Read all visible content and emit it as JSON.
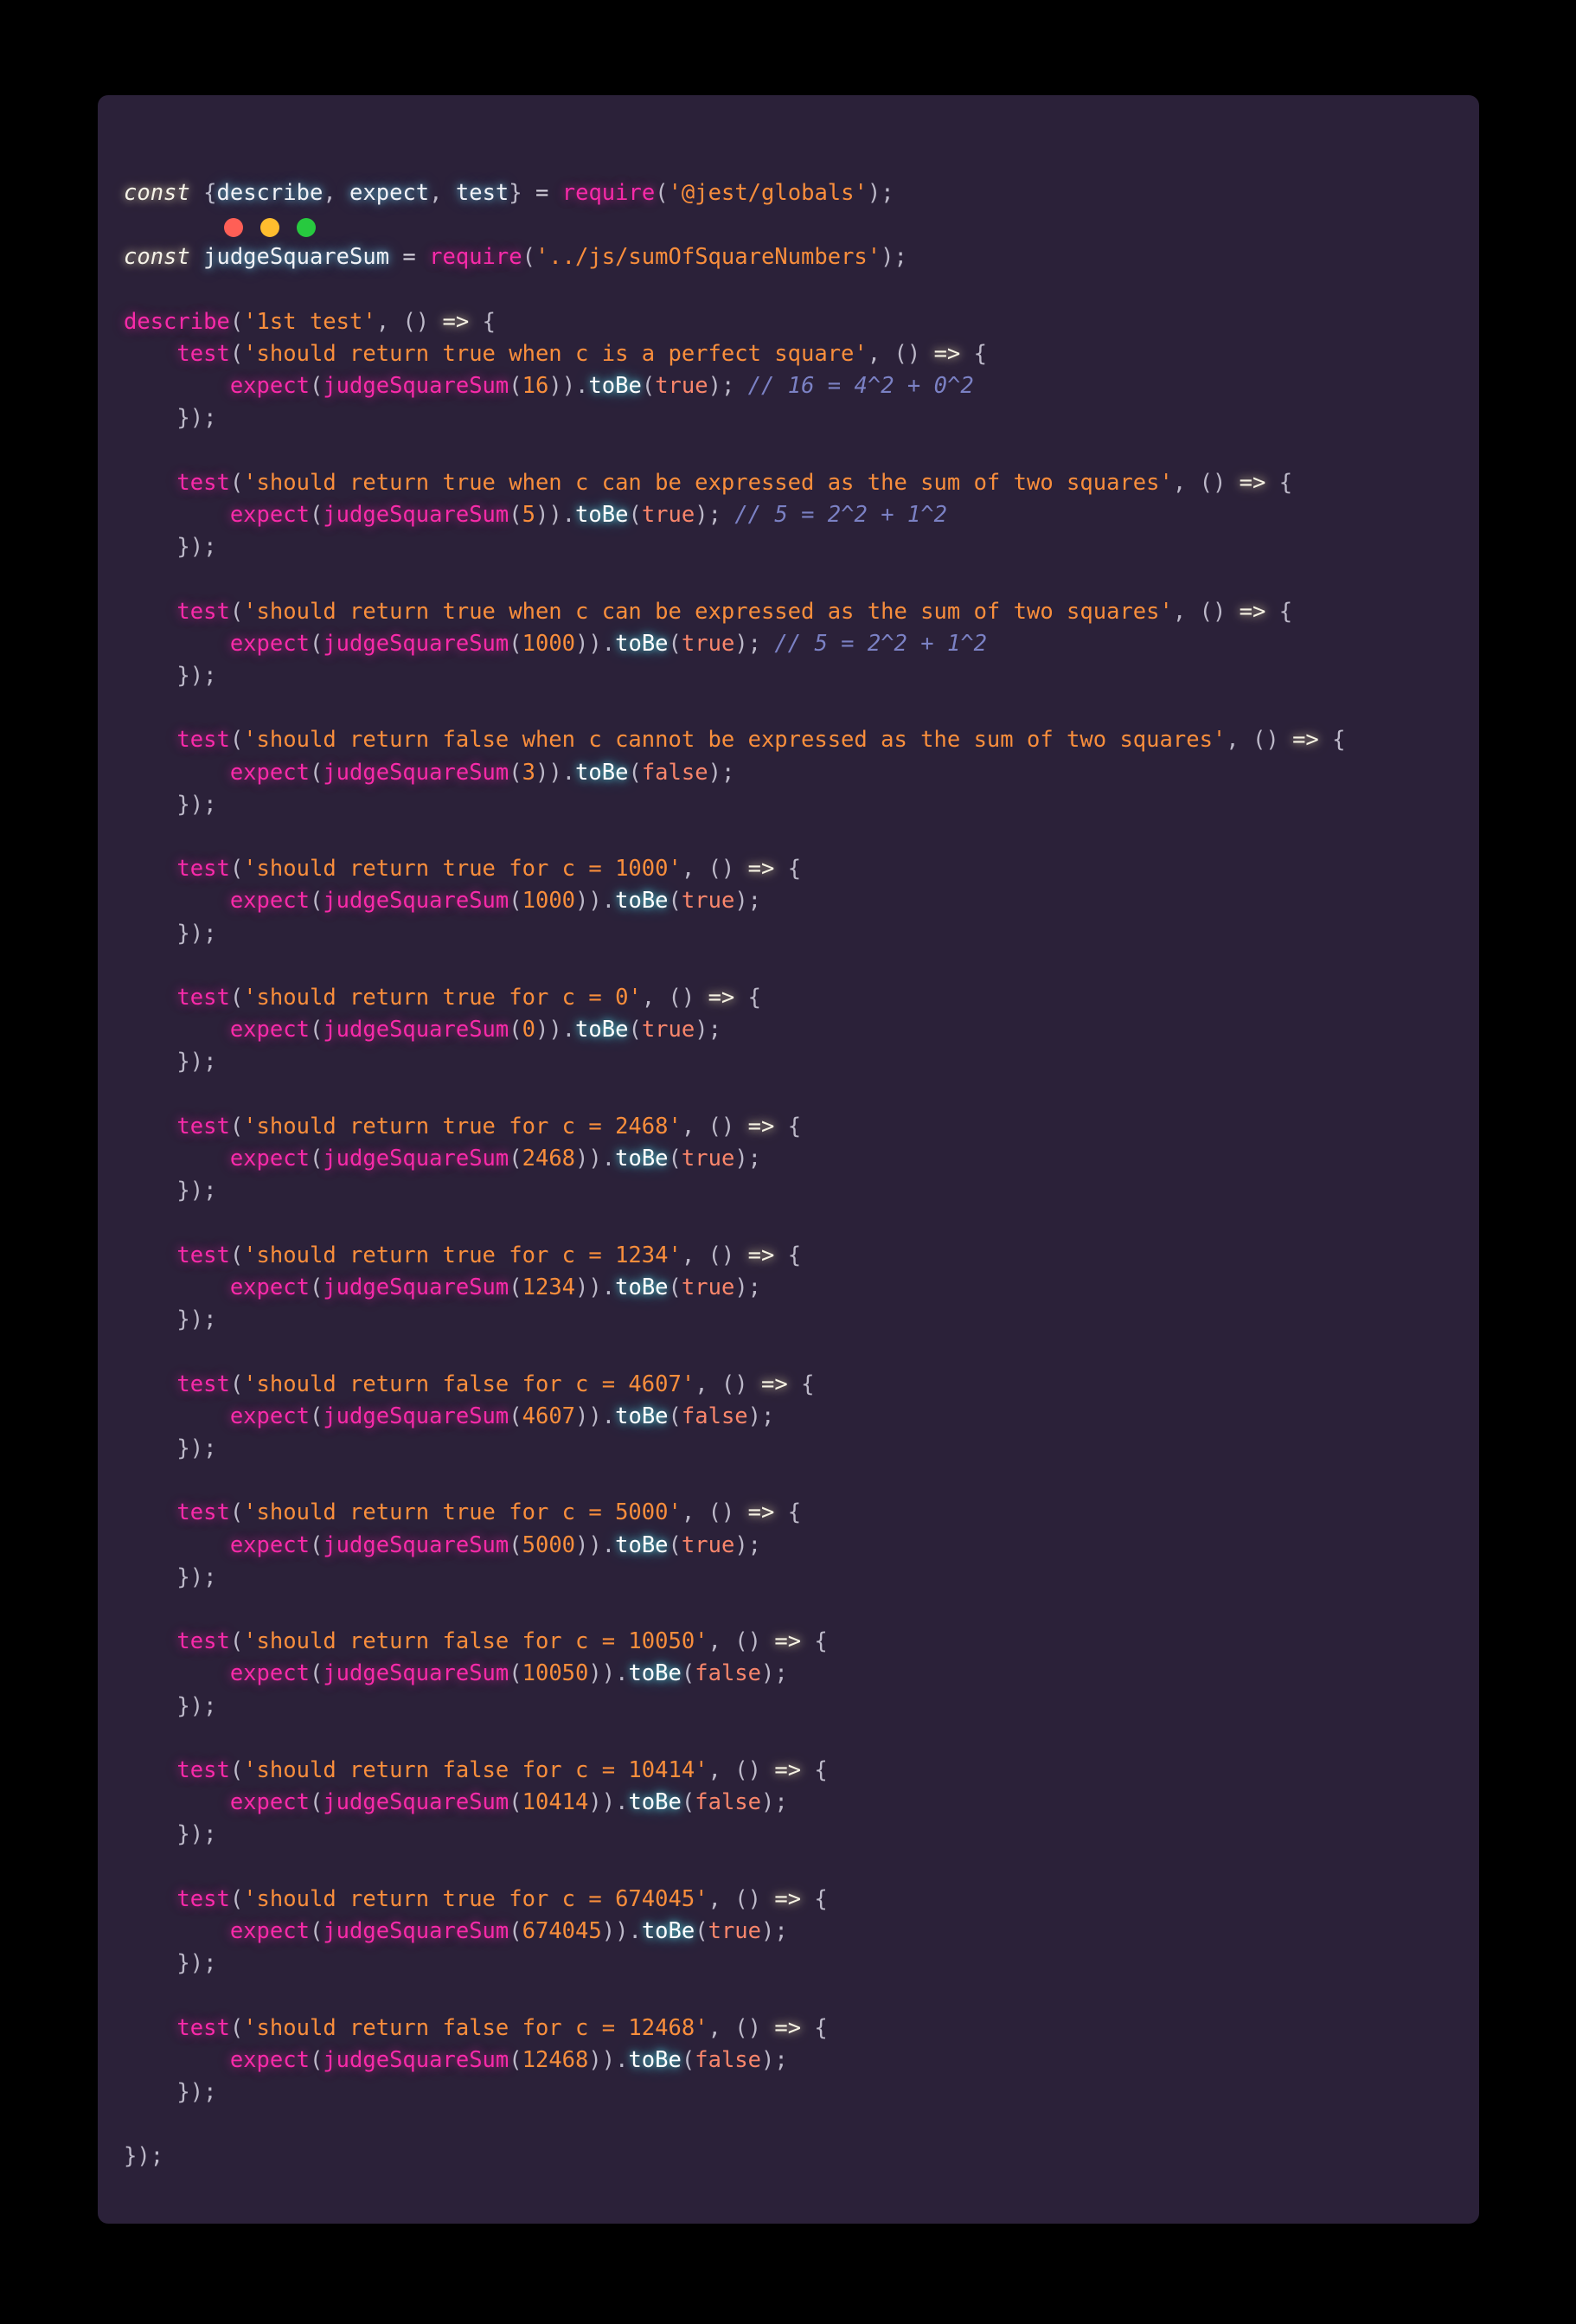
{
  "window": {
    "dots": [
      {
        "name": "close",
        "color": "#ff5f56"
      },
      {
        "name": "minimize",
        "color": "#ffbd2e"
      },
      {
        "name": "maximize",
        "color": "#27c93f"
      }
    ]
  },
  "editor": {
    "language": "javascript",
    "function_under_test": "judgeSquareSum",
    "module_path": "../js/sumOfSquareNumbers",
    "test_framework_import": "@jest/globals",
    "suite_name": "1st test",
    "imports": [
      {
        "keyword": "const",
        "destructured": [
          "describe",
          "expect",
          "test"
        ],
        "source": "@jest/globals"
      },
      {
        "keyword": "const",
        "binding": "judgeSquareSum",
        "source": "../js/sumOfSquareNumbers"
      }
    ],
    "tests": [
      {
        "title": "should return true when c is a perfect square",
        "arg": "16",
        "expected": "true",
        "comment": "// 16 = 4^2 + 0^2"
      },
      {
        "title": "should return true when c can be expressed as the sum of two squares",
        "arg": "5",
        "expected": "true",
        "comment": "// 5 = 2^2 + 1^2"
      },
      {
        "title": "should return true when c can be expressed as the sum of two squares",
        "arg": "1000",
        "expected": "true",
        "comment": "// 5 = 2^2 + 1^2"
      },
      {
        "title": "should return false when c cannot be expressed as the sum of two squares",
        "arg": "3",
        "expected": "false",
        "comment": ""
      },
      {
        "title": "should return true for c = 1000",
        "arg": "1000",
        "expected": "true",
        "comment": ""
      },
      {
        "title": "should return true for c = 0",
        "arg": "0",
        "expected": "true",
        "comment": ""
      },
      {
        "title": "should return true for c = 2468",
        "arg": "2468",
        "expected": "true",
        "comment": ""
      },
      {
        "title": "should return true for c = 1234",
        "arg": "1234",
        "expected": "true",
        "comment": ""
      },
      {
        "title": "should return false for c = 4607",
        "arg": "4607",
        "expected": "false",
        "comment": ""
      },
      {
        "title": "should return true for c = 5000",
        "arg": "5000",
        "expected": "true",
        "comment": ""
      },
      {
        "title": "should return false for c = 10050",
        "arg": "10050",
        "expected": "false",
        "comment": ""
      },
      {
        "title": "should return false for c = 10414",
        "arg": "10414",
        "expected": "false",
        "comment": ""
      },
      {
        "title": "should return true for c = 674045",
        "arg": "674045",
        "expected": "true",
        "comment": ""
      },
      {
        "title": "should return false for c = 12468",
        "arg": "12468",
        "expected": "false",
        "comment": ""
      }
    ],
    "syntax": {
      "keyword": "const",
      "describe": "describe",
      "test": "test",
      "expect": "expect",
      "require": "require",
      "matcher": "toBe",
      "arrow": "=>",
      "close_block": "});"
    },
    "colors": {
      "background": "#2b2139",
      "page_background": "#000000",
      "keyword": "#f6f3e8",
      "variable": "#f2f2f7",
      "function": "#f92aa9",
      "string": "#f98e3c",
      "number": "#f98e3c",
      "boolean": "#f9866b",
      "punctuation": "#bdb9c9",
      "method": "#ffffff",
      "comment": "#7b81c4"
    }
  }
}
